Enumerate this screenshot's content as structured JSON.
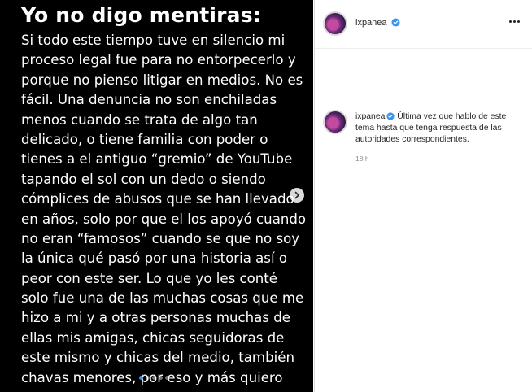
{
  "post": {
    "title": "Yo no digo mentiras:",
    "lines": [
      "Si todo este tiempo tuve en silencio mi",
      "proceso legal fue para no entorpecerlo y",
      "porque no pienso litigar en medios. No es",
      "fácil. Una denuncia no son enchiladas",
      "menos cuando se trata de algo tan",
      "delicado, o tiene familia con poder o",
      "tienes a el antiguo “gremio” de YouTube",
      "tapando el sol con un dedo o siendo",
      "cómplices de abusos  que se han llevado",
      "en años, solo por que el los apoyó cuando",
      "no eran “famosos” cuando se que no soy",
      "la única qué pasó por una historia así o",
      "peor con este ser.  Lo que yo les conté",
      "solo fue una de las muchas cosas que me",
      "hizo a mi y a otras personas muchas de",
      "ellas mis amigas, chicas seguidoras de",
      "este mismo y chicas del medio, también",
      "chavas menores, por eso y más quiero"
    ],
    "carousel": {
      "total": 5,
      "active": 0
    },
    "next_icon": "chevron-right-icon"
  },
  "header": {
    "username": "ixpanea",
    "verified_icon": "verified-badge-icon",
    "more_icon": "more-horizontal-icon"
  },
  "caption": {
    "username": "ixpanea",
    "text": "Última vez que hablo de este tema hasta que tenga respuesta de las autoridades correspondientes.",
    "timestamp": "18 h"
  },
  "colors": {
    "media_bg": "#000000",
    "verified": "#3897f0",
    "text": "#262626",
    "muted": "#8e8e8e",
    "border": "#dbdbdb"
  }
}
